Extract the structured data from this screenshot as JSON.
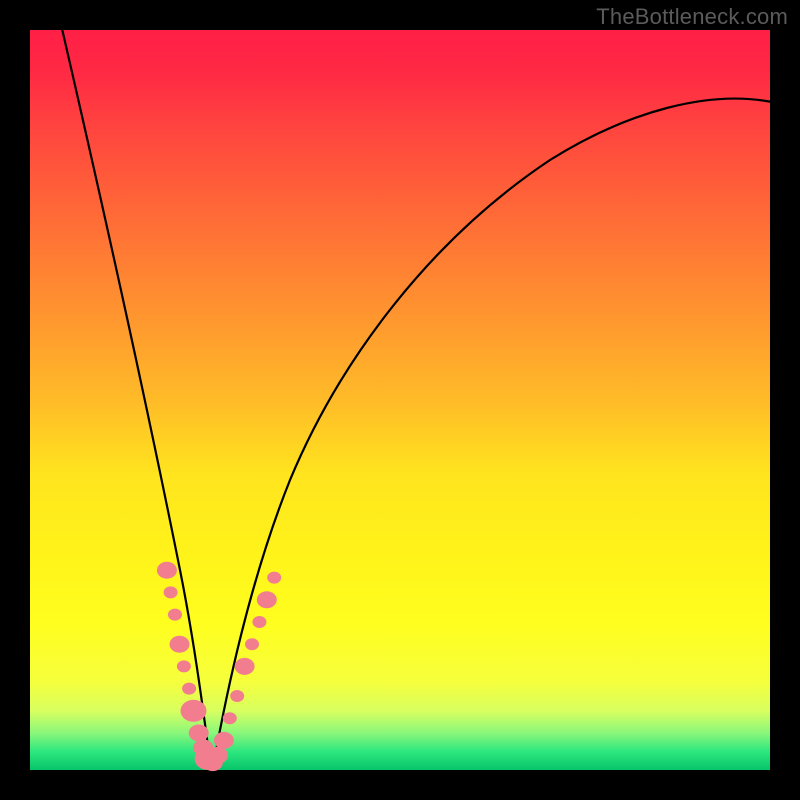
{
  "watermark": "TheBottleneck.com",
  "colors": {
    "frame": "#000000",
    "curve": "#000000",
    "marker": "#f27d8f",
    "marker_stroke": "#e36a7e"
  },
  "chart_data": {
    "type": "line",
    "title": "",
    "xlabel": "",
    "ylabel": "",
    "xlim": [
      0,
      100
    ],
    "ylim": [
      0,
      100
    ],
    "grid": false,
    "legend": false,
    "annotations": [
      "TheBottleneck.com"
    ],
    "series": [
      {
        "name": "bottleneck-curve",
        "note": "V-shaped curve; values estimated from pixel position since axes are unlabeled. y=100 at top, y≈0 at trough near x≈24.",
        "x": [
          4,
          8,
          12,
          16,
          20,
          22,
          23,
          24,
          25,
          26,
          28,
          30,
          34,
          38,
          44,
          52,
          62,
          74,
          88,
          100
        ],
        "y": [
          100,
          79,
          59,
          40,
          18,
          8,
          3,
          0,
          1,
          3,
          8,
          14,
          25,
          35,
          47,
          58,
          69,
          78,
          85,
          90
        ]
      }
    ],
    "markers": {
      "note": "Pink bead-like markers clustered along the lower V near the trough",
      "points": [
        {
          "x": 18.5,
          "y": 27
        },
        {
          "x": 19.0,
          "y": 24
        },
        {
          "x": 19.6,
          "y": 21
        },
        {
          "x": 20.2,
          "y": 17
        },
        {
          "x": 20.8,
          "y": 14
        },
        {
          "x": 21.5,
          "y": 11
        },
        {
          "x": 22.1,
          "y": 8
        },
        {
          "x": 22.8,
          "y": 5
        },
        {
          "x": 23.4,
          "y": 3
        },
        {
          "x": 24.0,
          "y": 1.5
        },
        {
          "x": 24.7,
          "y": 1
        },
        {
          "x": 25.4,
          "y": 2
        },
        {
          "x": 26.2,
          "y": 4
        },
        {
          "x": 27.0,
          "y": 7
        },
        {
          "x": 28.0,
          "y": 10
        },
        {
          "x": 29.0,
          "y": 14
        },
        {
          "x": 30.0,
          "y": 17
        },
        {
          "x": 31.0,
          "y": 20
        },
        {
          "x": 32.0,
          "y": 23
        },
        {
          "x": 33.0,
          "y": 26
        }
      ]
    }
  }
}
